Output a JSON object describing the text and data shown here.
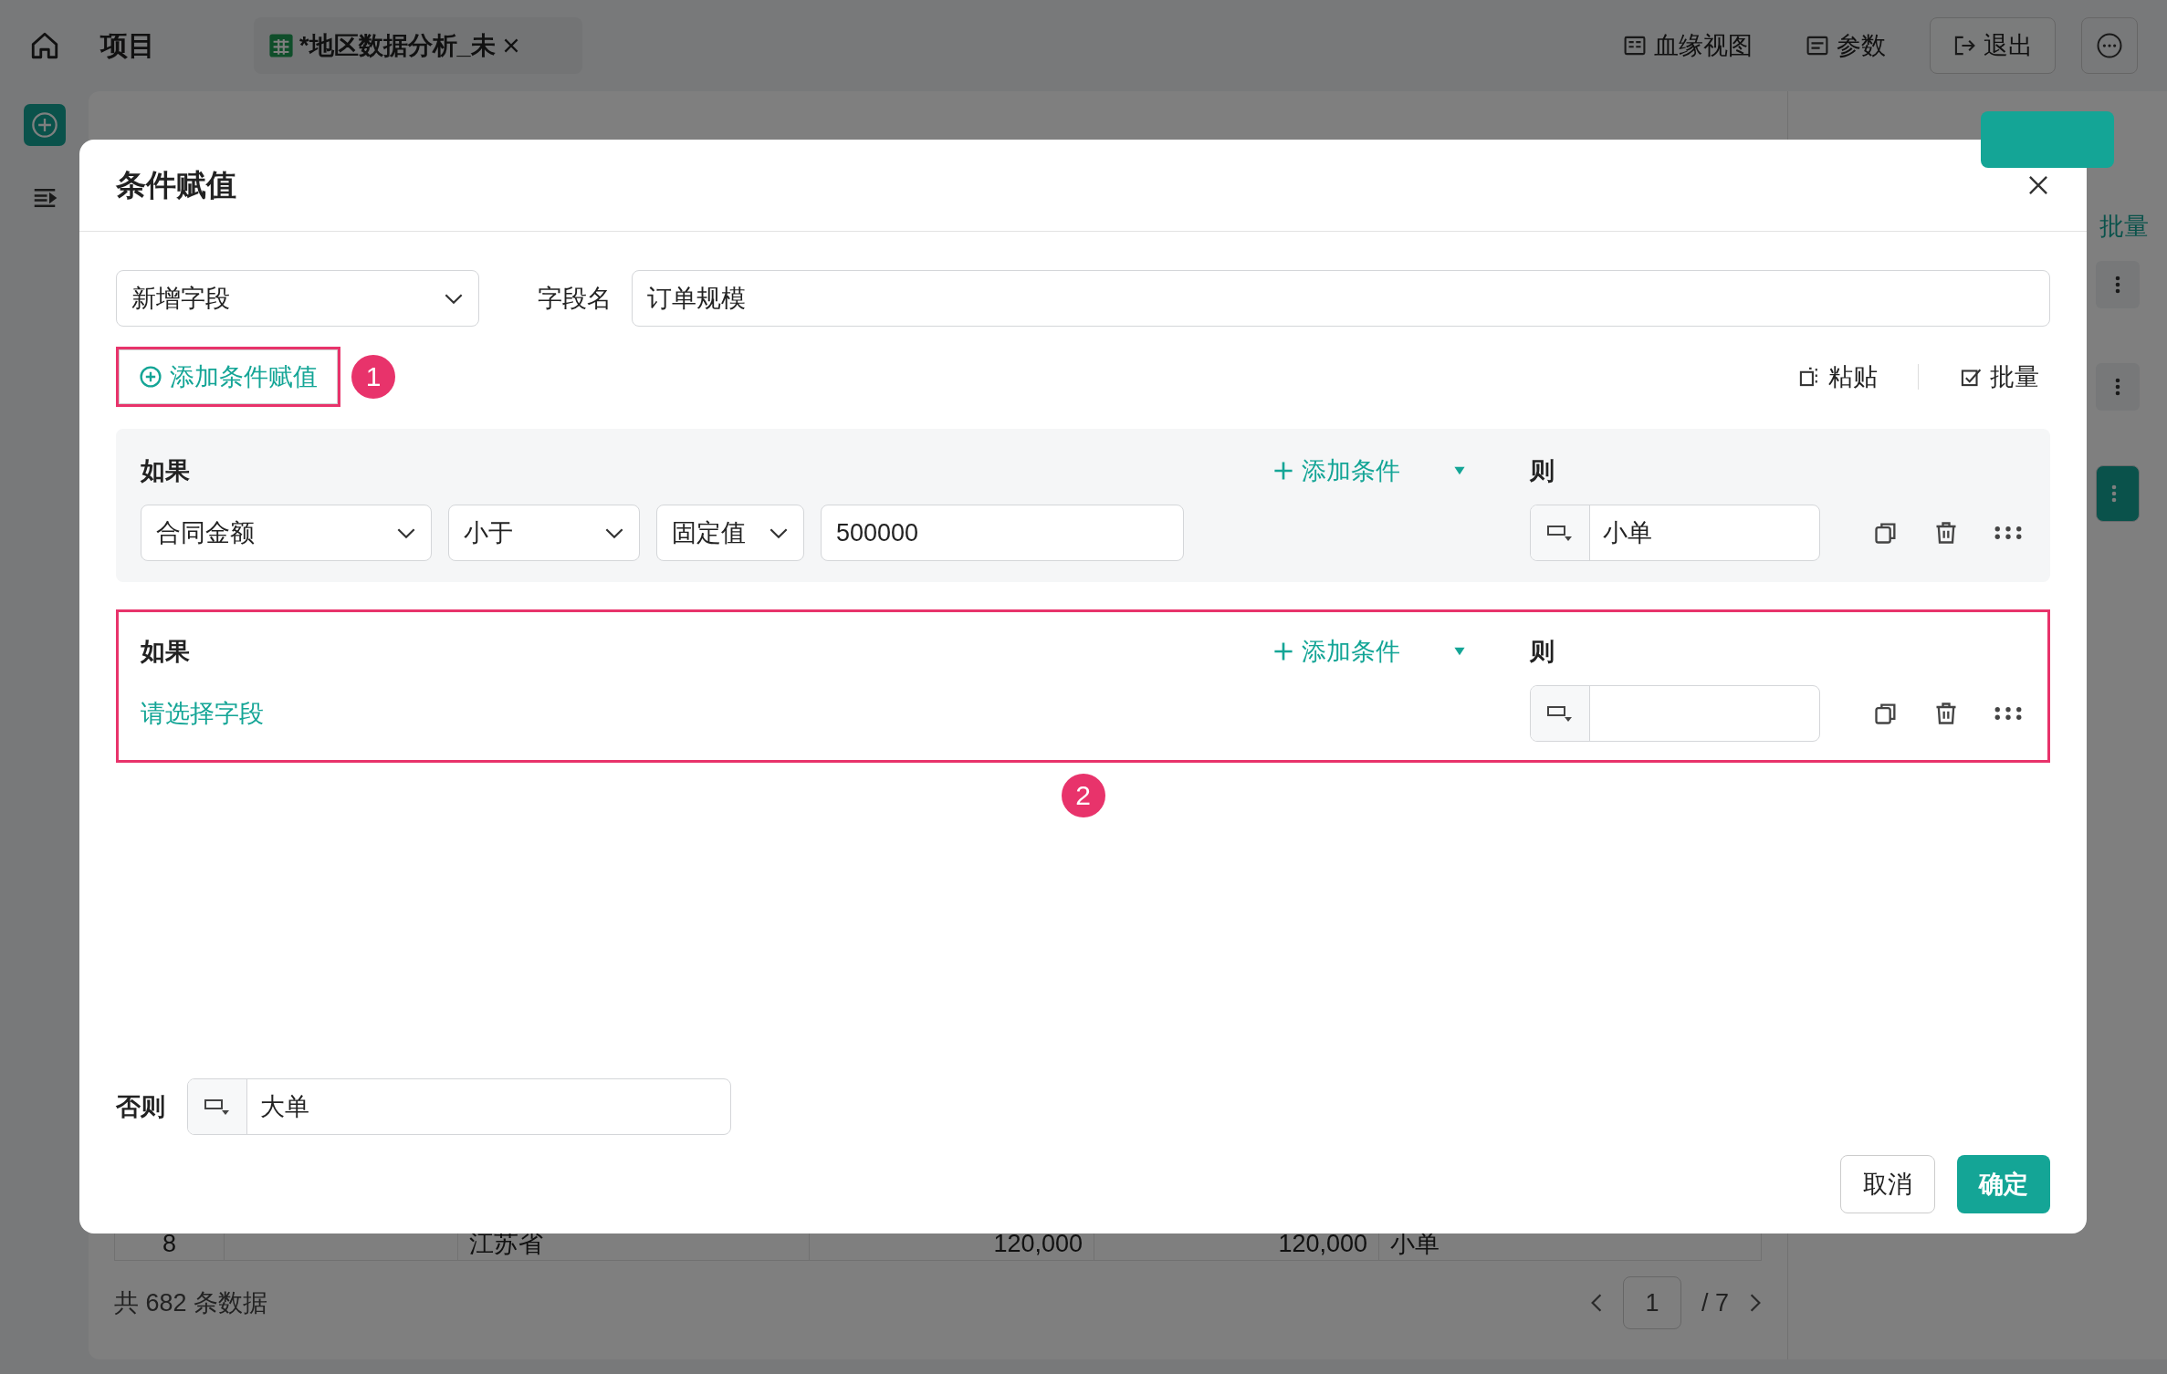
{
  "top_bar": {
    "home_title": "项目",
    "tab": {
      "title": "*地区数据分析_未"
    },
    "actions": [
      "血缘视图",
      "参数"
    ],
    "exit_button": "退出"
  },
  "side_panel": {
    "batch_label": "批量",
    "rows": [
      {
        "selected": false
      },
      {
        "selected": false
      },
      {
        "selected": true
      }
    ]
  },
  "table": {
    "rows": [
      {
        "cells": [
          "8",
          "江苏省",
          "120,000",
          "120,000",
          "小单"
        ]
      }
    ]
  },
  "footer": {
    "total": "共 682 条数据",
    "page": "1",
    "pages": "/ 7"
  },
  "dialog": {
    "title": "条件赋值",
    "mode_select": "新增字段",
    "field_name_label": "字段名",
    "field_name_value": "订单规模",
    "add_rule_button": {
      "label": "添加条件赋值",
      "highlighted": true,
      "annotation": "1"
    },
    "tools": [
      "粘贴",
      "批量"
    ],
    "rules": [
      {
        "if_label": "如果",
        "add_condition": "添加条件",
        "then_label": "则",
        "highlighted": false,
        "conditions": [
          {
            "field": "合同金额",
            "operator": "小于",
            "value_type": "固定值",
            "value": "500000"
          }
        ],
        "result": "小单"
      },
      {
        "if_label": "如果",
        "add_condition": "添加条件",
        "then_label": "则",
        "highlighted": true,
        "annotation": "2",
        "field_prompt": "请选择字段"
      }
    ],
    "else": {
      "label": "否则",
      "value": "大单"
    },
    "buttons": [
      {
        "label": "取消",
        "kind": "secondary"
      },
      {
        "label": "确定",
        "kind": "primary"
      }
    ]
  }
}
